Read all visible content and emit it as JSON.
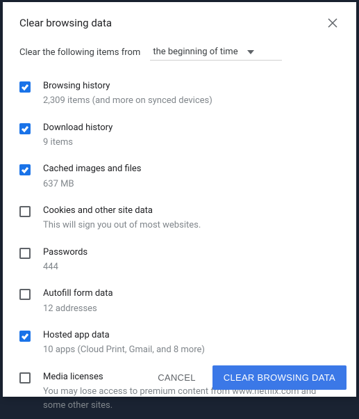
{
  "title": "Clear browsing data",
  "subheader_text": "Clear the following items from",
  "dropdown_value": "the beginning of time",
  "items": [
    {
      "label": "Browsing history",
      "sub": "2,309 items (and more on synced devices)",
      "checked": true
    },
    {
      "label": "Download history",
      "sub": "9 items",
      "checked": true
    },
    {
      "label": "Cached images and files",
      "sub": "637 MB",
      "checked": true
    },
    {
      "label": "Cookies and other site data",
      "sub": "This will sign you out of most websites.",
      "checked": false
    },
    {
      "label": "Passwords",
      "sub": "444",
      "checked": false
    },
    {
      "label": "Autofill form data",
      "sub": "12 addresses",
      "checked": false
    },
    {
      "label": "Hosted app data",
      "sub": "10 apps (Cloud Print, Gmail, and 8 more)",
      "checked": true
    },
    {
      "label": "Media licenses",
      "sub": "You may lose access to premium content from www.netflix.com and some other sites.",
      "checked": false
    }
  ],
  "buttons": {
    "cancel": "CANCEL",
    "confirm": "CLEAR BROWSING DATA"
  }
}
